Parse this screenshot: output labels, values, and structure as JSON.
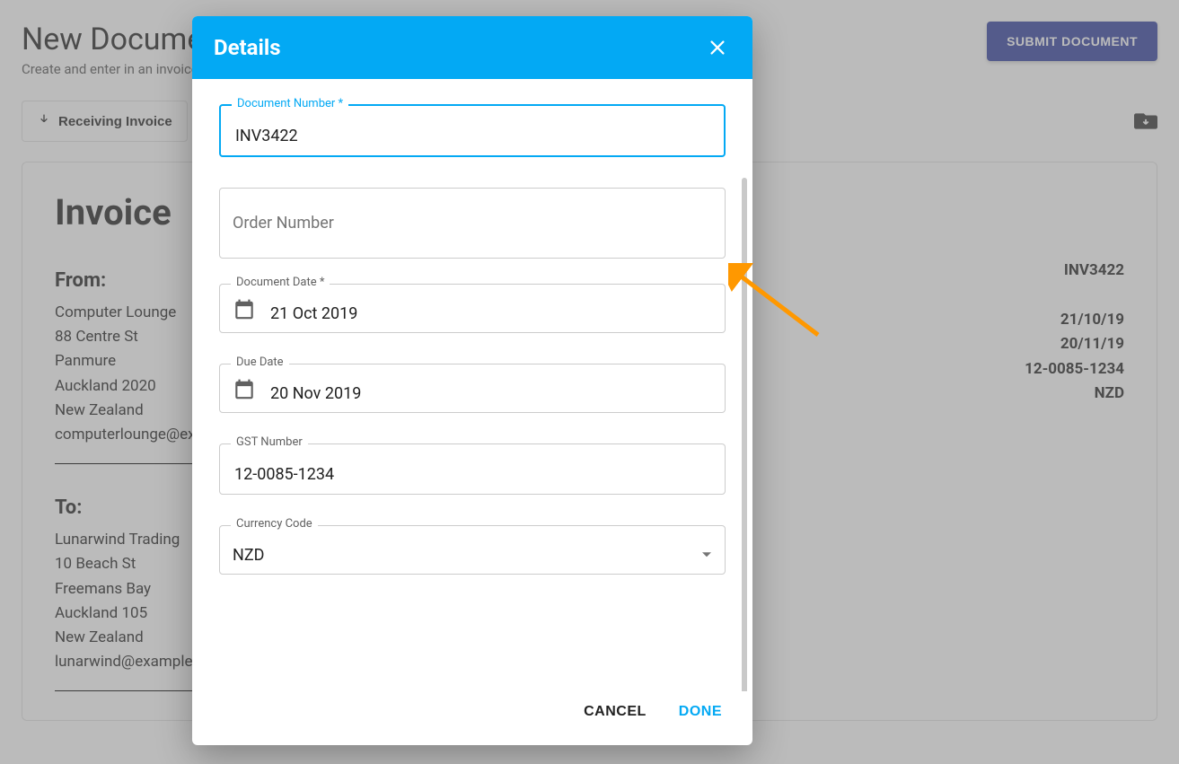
{
  "page": {
    "title": "New Document",
    "subtitle": "Create and enter in an invoice",
    "submit_label": "SUBMIT DOCUMENT",
    "receiving_label": "Receiving Invoice"
  },
  "invoice": {
    "heading": "Invoice",
    "from_label": "From:",
    "from_lines": [
      "Computer Lounge",
      "88 Centre St",
      "Panmure",
      "Auckland 2020",
      "New Zealand",
      "computerlounge@example.com"
    ],
    "to_label": "To:",
    "to_lines": [
      "Lunarwind Trading",
      "10 Beach St",
      "Freemans Bay",
      "Auckland 105",
      "New Zealand",
      "lunarwind@example.com"
    ],
    "meta": {
      "number": "INV3422",
      "date": "21/10/19",
      "due": "20/11/19",
      "gst": "12-0085-1234",
      "currency": "NZD"
    }
  },
  "modal": {
    "title": "Details",
    "fields": {
      "document_number_label": "Document Number *",
      "document_number_value": "INV3422",
      "order_number_placeholder": "Order Number",
      "document_date_label": "Document Date *",
      "document_date_value": "21 Oct 2019",
      "due_date_label": "Due Date",
      "due_date_value": "20 Nov 2019",
      "gst_label": "GST Number",
      "gst_value": "12-0085-1234",
      "currency_label": "Currency Code",
      "currency_value": "NZD"
    },
    "cancel_label": "CANCEL",
    "done_label": "DONE"
  }
}
